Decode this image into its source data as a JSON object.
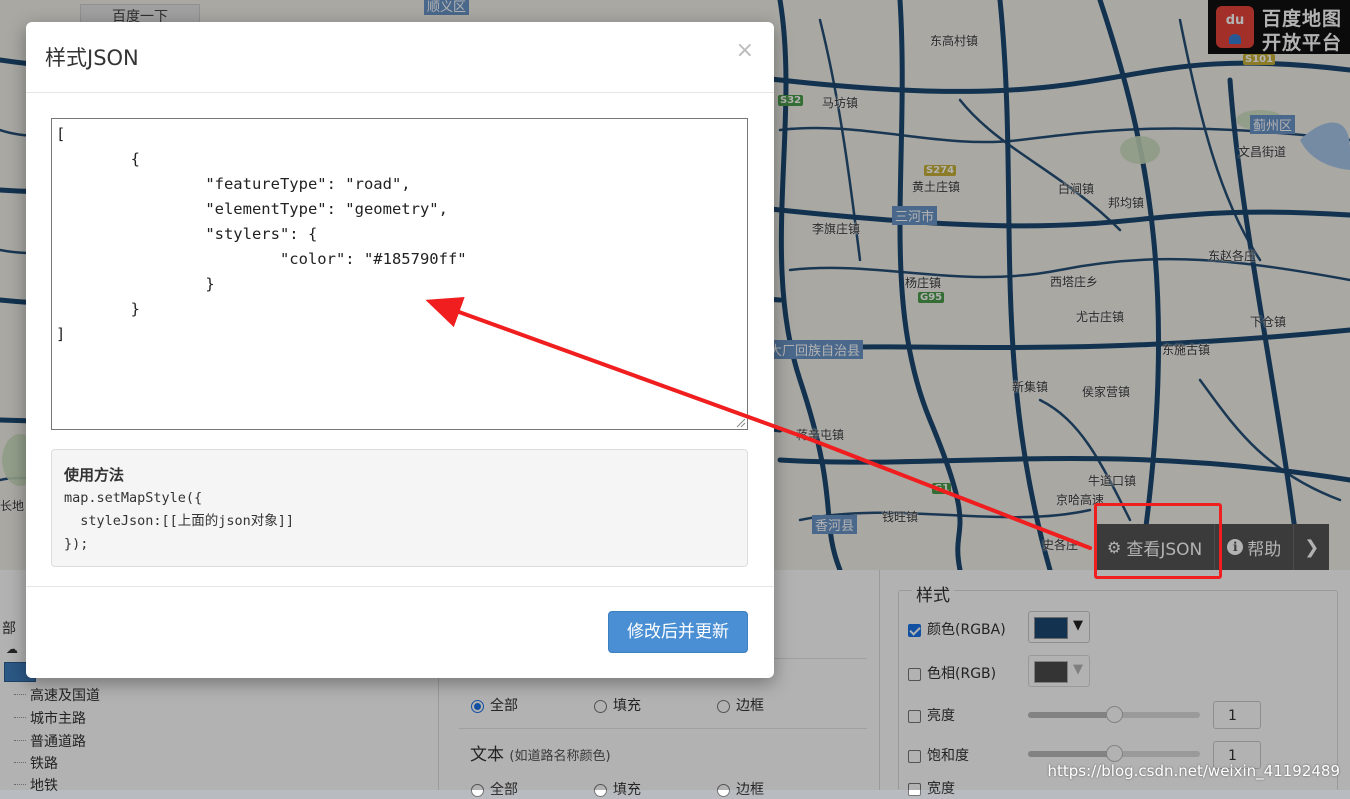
{
  "map": {
    "search_tab": "百度一下",
    "logo_line1": "百度地图",
    "logo_line2": "开放平台",
    "logo_badge": "du",
    "towns": [
      "东高村镇",
      "马坊镇",
      "黄土庄镇",
      "李旗庄镇",
      "杨庄镇",
      "西塔庄乡",
      "尤古庄镇",
      "下仓镇",
      "东施古镇",
      "新集镇",
      "侯家营镇",
      "蒋辛屯镇",
      "牛道口镇",
      "京哈高速",
      "钱旺镇",
      "东赵各庄",
      "邦均镇",
      "白涧镇",
      "文昌街道",
      "长地",
      "史各庄"
    ],
    "districts": [
      "顺义区",
      "三河市",
      "大厂回族自治县",
      "香河县",
      "蓟州区"
    ],
    "shields": [
      "S32",
      "S274",
      "G95",
      "G1",
      "S101"
    ],
    "toolbar": {
      "view_json": "查看JSON",
      "help": "帮助",
      "more_icon": "chevron-down-icon"
    }
  },
  "modal": {
    "title": "样式JSON",
    "close": "×",
    "json_text": "[\n\t{\n\t\t\"featureType\": \"road\",\n\t\t\"elementType\": \"geometry\",\n\t\t\"stylers\": {\n\t\t\t\"color\": \"#185790ff\"\n\t\t}\n\t}\n]",
    "usage_title": "使用方法",
    "usage_code": "map.setMapStyle({\n  styleJson:[[上面的json对象]]\n});",
    "submit": "修改后并更新"
  },
  "left_panel": {
    "items": [
      "部",
      "高速及国道",
      "城市主路",
      "普通道路",
      "铁路",
      "地铁"
    ]
  },
  "mid_panel": {
    "radio_options": [
      "全部",
      "填充",
      "边框"
    ],
    "text_section": "文本",
    "text_hint": "(如道路名称颜色)",
    "text_radio_options": [
      "全部",
      "填充",
      "边框"
    ]
  },
  "style_panel": {
    "title": "样式",
    "color_label": "颜色(RGBA)",
    "color_value": "#1a4872",
    "hue_label": "色相(RGB)",
    "hue_value": "#000000",
    "brightness_label": "亮度",
    "brightness_value": "1",
    "saturation_label": "饱和度",
    "saturation_value": "1",
    "width_label": "宽度"
  },
  "watermark": "https://blog.csdn.net/weixin_41192489",
  "colors": {
    "road": "#1a4872",
    "accent": "#4a8fd3",
    "highlight": "#f01e1e"
  }
}
